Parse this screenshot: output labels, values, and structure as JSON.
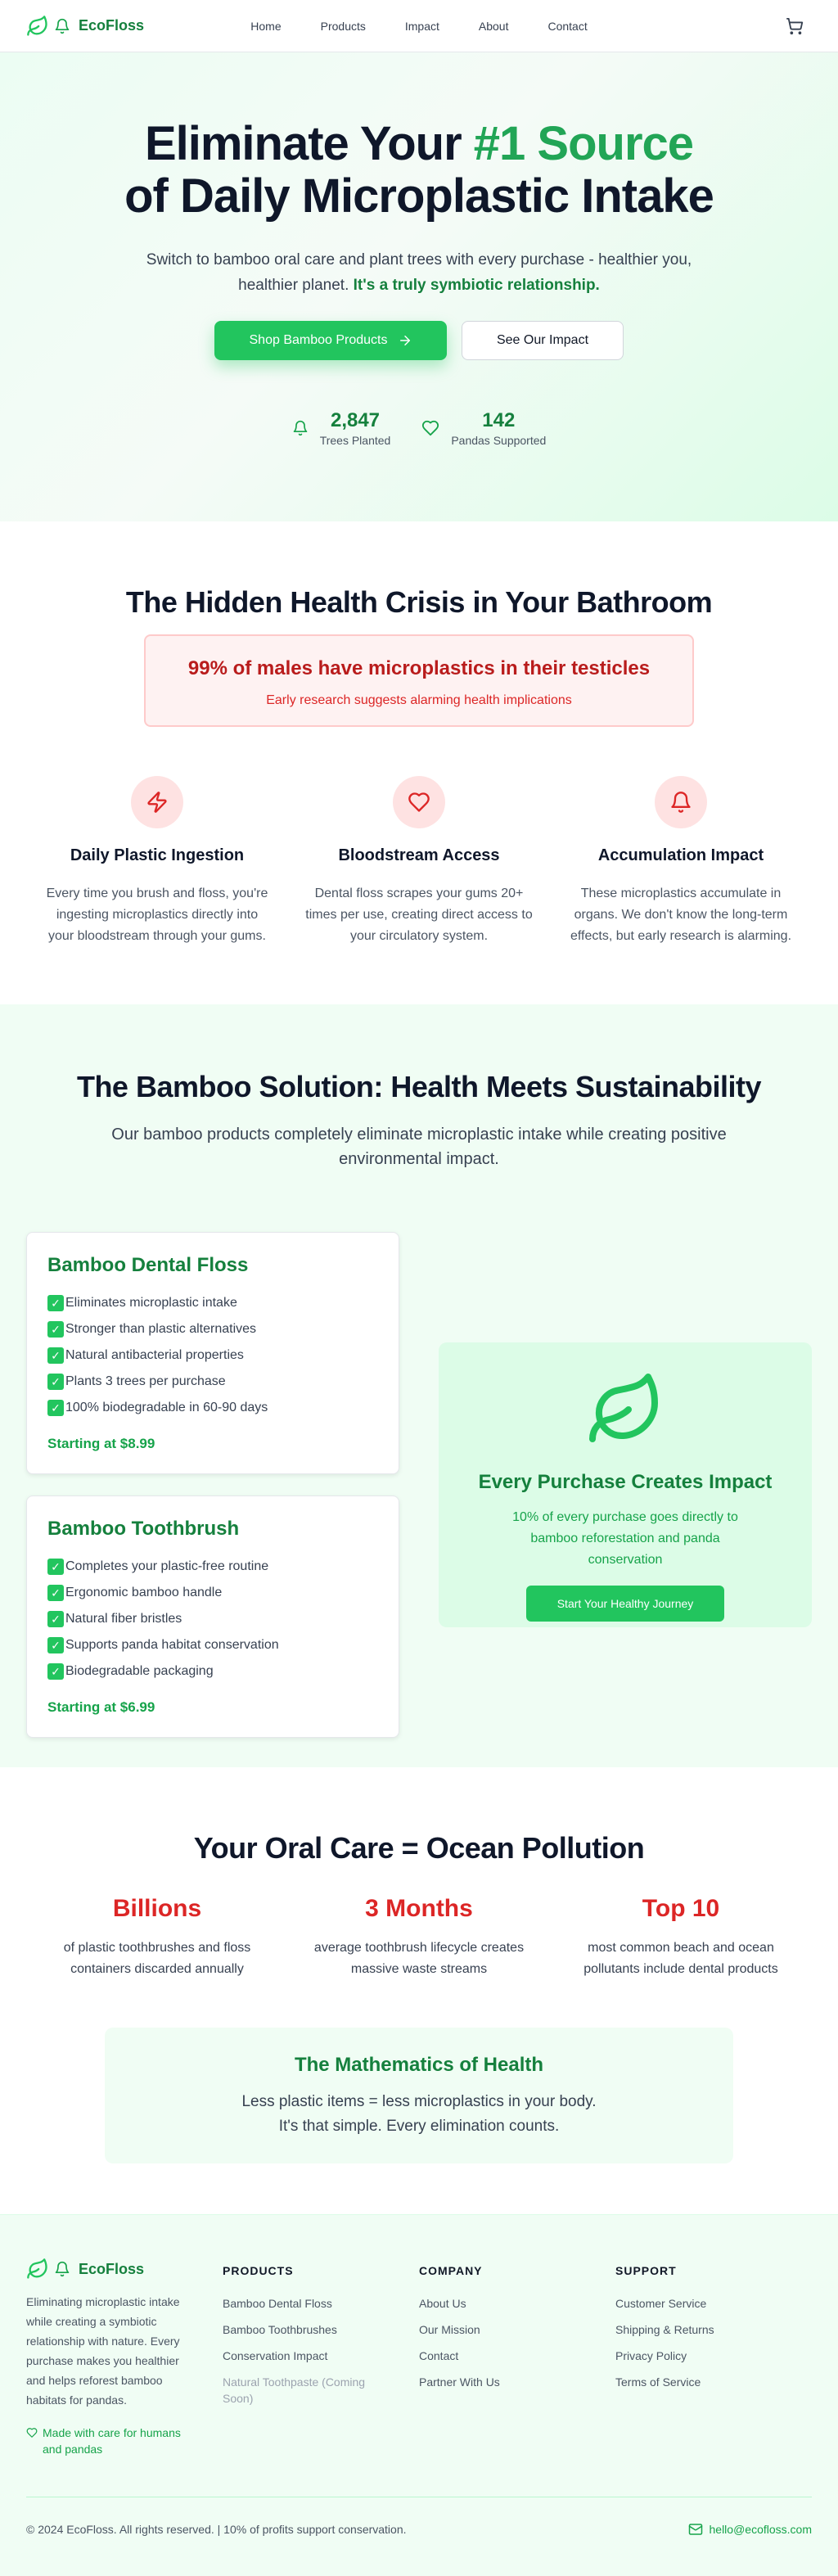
{
  "nav": {
    "brand": "EcoFloss",
    "links": [
      "Home",
      "Products",
      "Impact",
      "About",
      "Contact"
    ]
  },
  "hero": {
    "title_part1": "Eliminate Your ",
    "title_accent": "#1 Source",
    "title_part2": "of Daily Microplastic Intake",
    "subtitle": "Switch to bamboo oral care and plant trees with every purchase - healthier you, healthier planet. ",
    "subtitle_bold": "It's a truly symbiotic relationship.",
    "cta_primary": "Shop Bamboo Products",
    "cta_secondary": "See Our Impact",
    "stats": [
      {
        "value": "2,847",
        "label": "Trees Planted"
      },
      {
        "value": "142",
        "label": "Pandas Supported"
      }
    ]
  },
  "crisis": {
    "title": "The Hidden Health Crisis in Your Bathroom",
    "alert_title": "99% of males have microplastics in their testicles",
    "alert_sub": "Early research suggests alarming health implications",
    "items": [
      {
        "title": "Daily Plastic Ingestion",
        "text": "Every time you brush and floss, you're ingesting microplastics directly into your bloodstream through your gums."
      },
      {
        "title": "Bloodstream Access",
        "text": "Dental floss scrapes your gums 20+ times per use, creating direct access to your circulatory system."
      },
      {
        "title": "Accumulation Impact",
        "text": "These microplastics accumulate in organs. We don't know the long-term effects, but early research is alarming."
      }
    ]
  },
  "solution": {
    "title": "The Bamboo Solution: Health Meets Sustainability",
    "lead": "Our bamboo products completely eliminate microplastic intake while creating positive environmental impact.",
    "cards": [
      {
        "title": "Bamboo Dental Floss",
        "features": [
          "Eliminates microplastic intake",
          "Stronger than plastic alternatives",
          "Natural antibacterial properties",
          "Plants 3 trees per purchase",
          "100% biodegradable in 60-90 days"
        ],
        "price": "Starting at $8.99"
      },
      {
        "title": "Bamboo Toothbrush",
        "features": [
          "Completes your plastic-free routine",
          "Ergonomic bamboo handle",
          "Natural fiber bristles",
          "Supports panda habitat conservation",
          "Biodegradable packaging"
        ],
        "price": "Starting at $6.99"
      }
    ],
    "impact_title": "Every Purchase Creates Impact",
    "impact_text": "10% of every purchase goes directly to bamboo reforestation and panda conservation",
    "impact_cta": "Start Your Healthy Journey"
  },
  "pollution": {
    "title": "Your Oral Care = Ocean Pollution",
    "stats": [
      {
        "value": "Billions",
        "text": "of plastic toothbrushes and floss containers discarded annually"
      },
      {
        "value": "3 Months",
        "text": "average toothbrush lifecycle creates massive waste streams"
      },
      {
        "value": "Top 10",
        "text": "most common beach and ocean pollutants include dental products"
      }
    ],
    "math_title": "The Mathematics of Health",
    "math_line1": "Less plastic items = less microplastics in your body.",
    "math_line2": "It's that simple. Every elimination counts."
  },
  "footer": {
    "brand": "EcoFloss",
    "description": "Eliminating microplastic intake while creating a symbiotic relationship with nature. Every purchase makes you healthier and helps reforest bamboo habitats for pandas.",
    "love": "Made with care for humans and pandas",
    "products_heading": "PRODUCTS",
    "products": [
      "Bamboo Dental Floss",
      "Bamboo Toothbrushes",
      "Conservation Impact"
    ],
    "products_coming": "Natural Toothpaste (Coming Soon)",
    "company_heading": "COMPANY",
    "company": [
      "About Us",
      "Our Mission",
      "Contact",
      "Partner With Us"
    ],
    "support_heading": "SUPPORT",
    "support": [
      "Customer Service",
      "Shipping & Returns",
      "Privacy Policy",
      "Terms of Service"
    ],
    "copyright": "© 2024 EcoFloss. All rights reserved. | 10% of profits support conservation.",
    "email": "hello@ecofloss.com"
  },
  "colors": {
    "brand_green": "#15803d",
    "accent_green": "#22c55e",
    "alert_red": "#dc2626"
  },
  "icons": [
    "leaf-icon",
    "bell-sprout-icon",
    "cart-icon",
    "arrow-right-icon",
    "heart-icon",
    "zap-icon",
    "mail-icon",
    "check-icon"
  ]
}
